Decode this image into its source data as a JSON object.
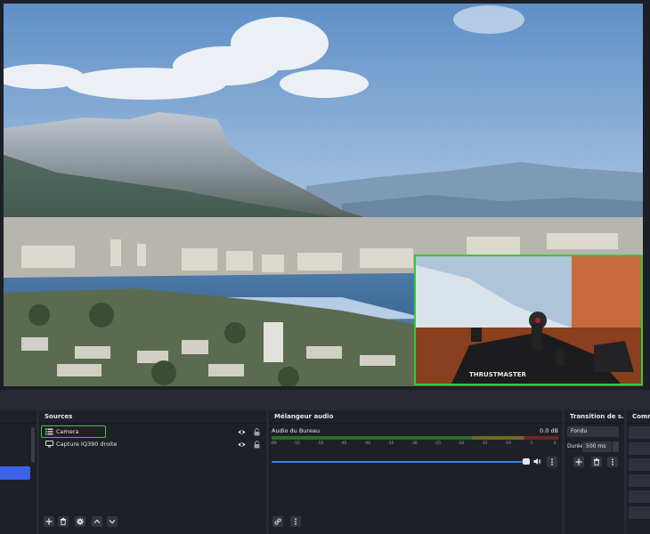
{
  "docks": {
    "sources_title": "Sources",
    "mixer_title": "Mélangeur audio",
    "transitions_title": "Transition de s…",
    "controls_title": "Comm"
  },
  "sources": [
    {
      "name": "Camera",
      "icon": "list-icon",
      "selected": true
    },
    {
      "name": "Capture IQ390 droite",
      "icon": "monitor-icon",
      "selected": false
    }
  ],
  "mixer": {
    "channel_name": "Audio du Bureau",
    "channel_level": "0.0 dB",
    "scale": [
      "-60",
      "-55",
      "-50",
      "-45",
      "-40",
      "-35",
      "-30",
      "-25",
      "-20",
      "-15",
      "-10",
      "-5",
      "0"
    ]
  },
  "transitions": {
    "type": "Fondu",
    "duration_label": "Durée",
    "duration_value": "500 ms"
  },
  "colors": {
    "accent": "#3b63e6",
    "source_highlight": "#39c73a",
    "volume_slider": "#3b82e6"
  }
}
